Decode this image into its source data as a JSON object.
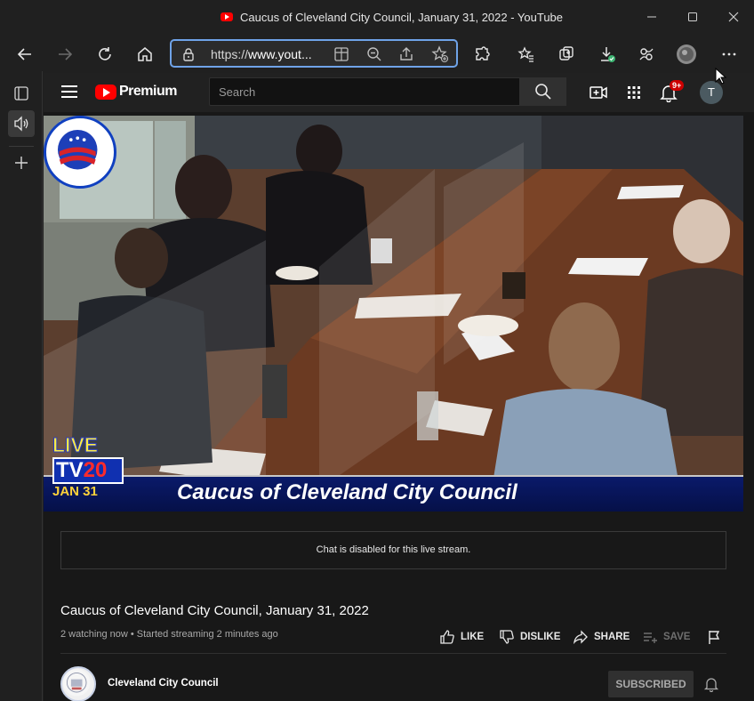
{
  "window": {
    "title": "Caucus of Cleveland City Council, January 31, 2022 - YouTube",
    "controls": [
      "minimize",
      "maximize",
      "close"
    ]
  },
  "browser": {
    "url_prefix": "https://",
    "url_host": "www.yout...",
    "toolbar_icons": [
      "back-icon",
      "forward-icon",
      "refresh-icon",
      "home-icon",
      "lock-icon",
      "reader-icon",
      "zoom-out-icon",
      "share-icon",
      "add-favorite-icon",
      "extensions-icon",
      "favorites-icon",
      "collections-icon",
      "downloads-icon",
      "profile-swap-icon",
      "profile-avatar",
      "more-icon"
    ]
  },
  "sidebar": {
    "icons": [
      "tab-actions-icon",
      "speaker-icon",
      "add-icon"
    ]
  },
  "youtube": {
    "logo_text": "Premium",
    "search_placeholder": "Search",
    "notification_count": "9+",
    "avatar_letter": "T",
    "video": {
      "overlay_caption": "Caucus of Cleveland City Council",
      "live_text": "LIVE",
      "tv_text": "TV",
      "tv_number": "20",
      "date_text": "JAN 31"
    },
    "chat_message": "Chat is disabled for this live stream.",
    "title": "Caucus of Cleveland City Council, January 31, 2022",
    "meta": "2 watching now • Started streaming 2 minutes ago",
    "actions": {
      "like": "LIKE",
      "dislike": "DISLIKE",
      "share": "SHARE",
      "save": "SAVE"
    },
    "channel": {
      "name": "Cleveland City Council",
      "subscribe_label": "SUBSCRIBED"
    }
  },
  "colors": {
    "accent_url_border": "#6fa3e8",
    "youtube_red": "#ff0000",
    "background": "#181818"
  }
}
